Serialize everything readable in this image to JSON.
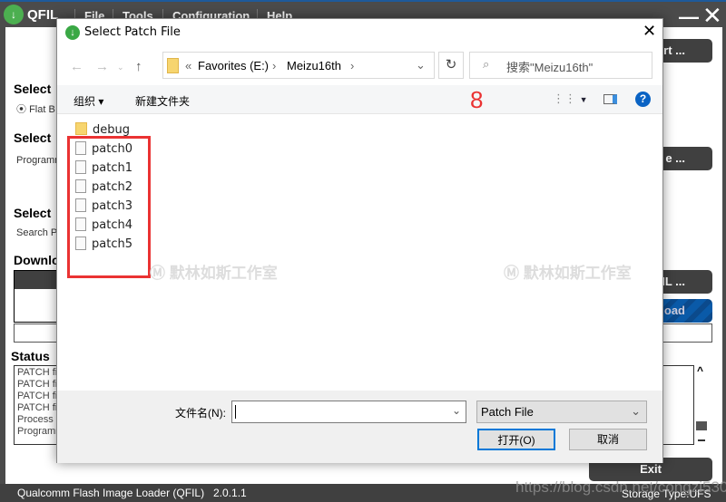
{
  "qfil": {
    "app_name": "QFIL",
    "menu": [
      "File",
      "Tools",
      "Configuration",
      "Help"
    ],
    "labels": [
      "Select",
      "Select",
      "Select",
      "Downlo",
      "Status"
    ],
    "flat_build": "Flat B",
    "programmer": "Programm",
    "search_path": "Search P",
    "buttons": {
      "port": "ort ...",
      "browse": "e ...",
      "load_xml": "IL ...",
      "download": "oad",
      "exit": "Exit"
    },
    "status_lines": [
      "PATCH fi",
      "PATCH fi",
      "PATCH fi",
      "PATCH fi",
      "Process l",
      "Programm"
    ],
    "footer": {
      "app_full_name": "Qualcomm Flash Image Loader (QFIL)",
      "version": "2.0.1.1",
      "storage_type": "Storage Type:UFS"
    }
  },
  "dialog": {
    "title": "Select Patch File",
    "breadcrumb": {
      "prefix": "«",
      "items": [
        "Favorites (E:)",
        "Meizu16th"
      ]
    },
    "search_placeholder": "搜索\"Meizu16th\"",
    "toolbar": {
      "organize": "组织 ▾",
      "new_folder": "新建文件夹",
      "annotation": "8"
    },
    "files": [
      {
        "name": "debug",
        "type": "folder"
      },
      {
        "name": "patch0",
        "type": "file"
      },
      {
        "name": "patch1",
        "type": "file"
      },
      {
        "name": "patch2",
        "type": "file"
      },
      {
        "name": "patch3",
        "type": "file"
      },
      {
        "name": "patch4",
        "type": "file"
      },
      {
        "name": "patch5",
        "type": "file"
      }
    ],
    "watermark_text": "默林如斯工作室",
    "filename_label": "文件名(N):",
    "filename_value": "",
    "filetype": "Patch File",
    "open_button": "打开(O)",
    "cancel_button": "取消"
  },
  "page_watermark": "https://blog.csdn.net/congzi530",
  "colors": {
    "qfil_dark": "#4b4b4b",
    "accent_blue": "#0067c0",
    "annotation_red": "#ea3232"
  }
}
